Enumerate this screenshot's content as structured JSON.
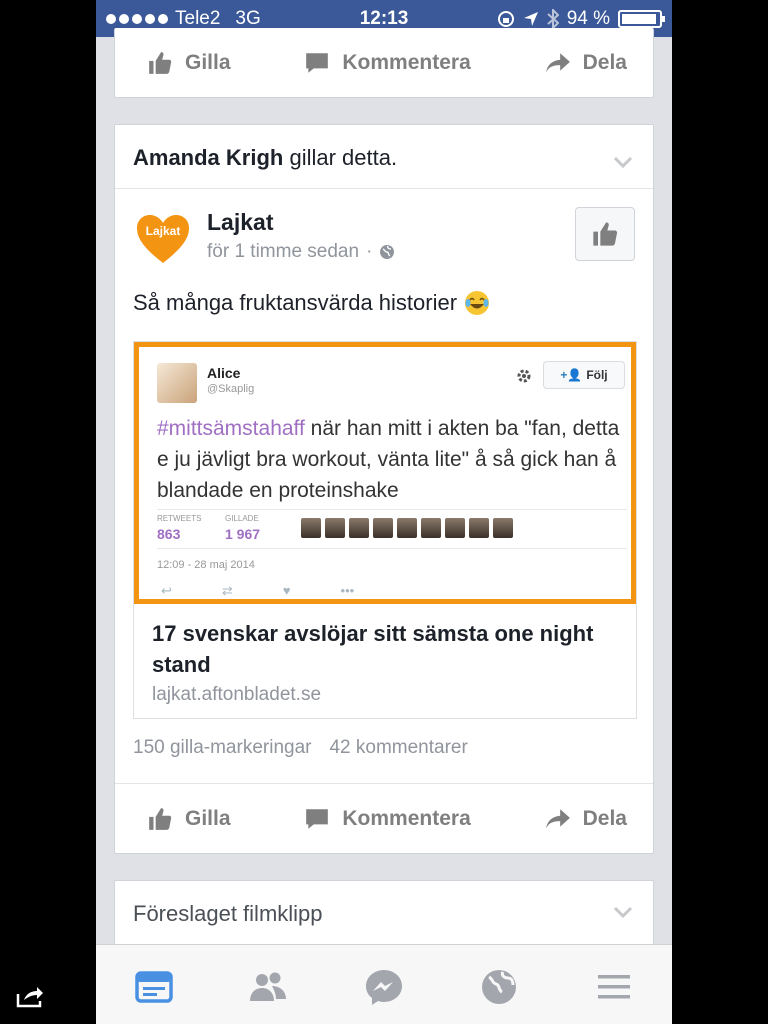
{
  "status_bar": {
    "carrier": "Tele2",
    "network": "3G",
    "time": "12:13",
    "battery": "94 %",
    "battery_level": 0.94
  },
  "top_actions": {
    "like": "Gilla",
    "comment": "Kommentera",
    "share": "Dela"
  },
  "post": {
    "social_context_name": "Amanda Krigh",
    "social_context_text": "gillar detta.",
    "page_logo_text": "Lajkat",
    "page_name": "Lajkat",
    "timestamp": "för 1 timme sedan",
    "separator": "·",
    "text": "Så många fruktansvärda historier",
    "embedded_tweet": {
      "name": "Alice",
      "handle": "@Skaplig",
      "follow_label": "Följ",
      "hashtag": "#mittsämstahaff",
      "body": " när han mitt i akten ba \"fan, detta e ju jävligt bra workout, vänta lite\" å så gick han å blandade en proteinshake",
      "retweets_label": "RETWEETS",
      "retweets_value": "863",
      "likes_label": "GILLADE",
      "likes_value": "1 967",
      "date": "12:09 - 28 maj 2014"
    },
    "link_title": "17 svenskar avslöjar sitt sämsta one night stand",
    "link_domain": "lajkat.aftonbladet.se",
    "likes_count": "150 gilla-markeringar",
    "comments_count": "42 kommentarer",
    "actions": {
      "like": "Gilla",
      "comment": "Kommentera",
      "share": "Dela"
    }
  },
  "suggested": {
    "title": "Föreslaget filmklipp"
  },
  "colors": {
    "facebook_blue": "#3b5998",
    "lajkat_orange": "#f39412",
    "hashtag_purple": "#a06fc3",
    "tab_active": "#4a90e2",
    "tab_inactive": "#a3a7ad"
  },
  "tabs": [
    "news-feed-icon",
    "friends-icon",
    "messenger-icon",
    "globe-icon",
    "menu-icon"
  ]
}
